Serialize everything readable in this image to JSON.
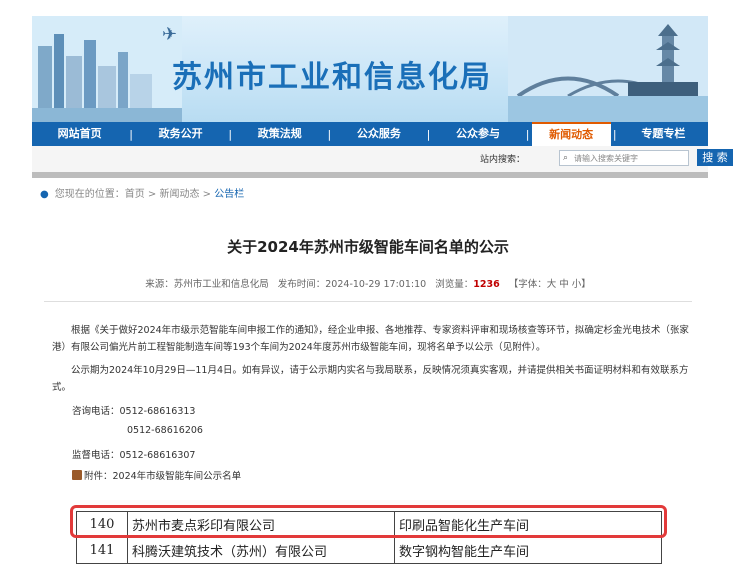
{
  "header": {
    "site_title": "苏州市工业和信息化局"
  },
  "nav": {
    "items": [
      {
        "label": "网站首页"
      },
      {
        "label": "政务公开"
      },
      {
        "label": "政策法规"
      },
      {
        "label": "公众服务"
      },
      {
        "label": "公众参与"
      },
      {
        "label": "新闻动态",
        "active": true
      },
      {
        "label": "专题专栏"
      }
    ]
  },
  "search": {
    "label": "站内搜索：",
    "placeholder": "请输入搜索关键字",
    "button": "搜 索"
  },
  "breadcrumb": {
    "prefix": "您现在的位置：",
    "home": "首页",
    "sep": " > ",
    "section": "新闻动态",
    "current": "公告栏"
  },
  "article": {
    "title": "关于2024年苏州市级智能车间名单的公示",
    "meta": {
      "source": "来源：苏州市工业和信息化局",
      "time": "发布时间：2024-10-29 17:01:10",
      "hits_label": "浏览量：",
      "hits": "1236",
      "font_ctrl": "【字体：大 中 小】"
    },
    "para1": "根据《关于做好2024年市级示范智能车间申报工作的通知》，经企业申报、各地推荐、专家资料评审和现场核查等环节，拟确定杉金光电技术（张家港）有限公司偏光片前工程智能制造车间等193个车间为2024年度苏州市级智能车间，现将名单予以公示（见附件）。",
    "para2": "公示期为2024年10月29日—11月4日。如有异议，请于公示期内实名与我局联系，反映情况须真实客观，并请提供相关书面证明材料和有效联系方式。",
    "contact1": "咨询电话：0512-68616313",
    "contact2": "0512-68616206",
    "supervise": "监督电话：0512-68616307",
    "attachment": "附件：2024年市级智能车间公示名单"
  },
  "table": {
    "rows": [
      {
        "num": "140",
        "company": "苏州市麦点彩印有限公司",
        "workshop": "印刷品智能化生产车间"
      },
      {
        "num": "141",
        "company": "科腾沃建筑技术（苏州）有限公司",
        "workshop": "数字钢构智能生产车间"
      }
    ]
  },
  "colors": {
    "brand": "#1565b0",
    "active_tab": "#e05a00",
    "highlight": "#e23a3a"
  }
}
